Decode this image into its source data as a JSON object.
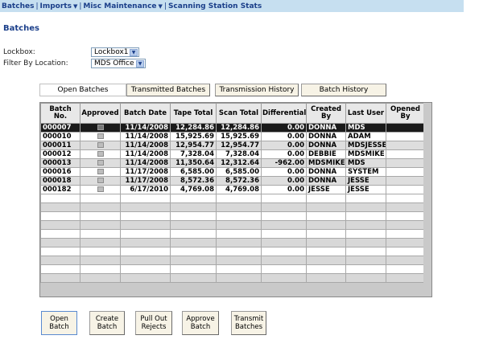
{
  "menu": {
    "batches": "Batches",
    "imports": "Imports",
    "misc_maintenance": "Misc Maintenance",
    "scanning_station_stats": "Scanning Station Stats"
  },
  "page_title": "Batches",
  "filters": {
    "lockbox_label": "Lockbox:",
    "lockbox_value": "Lockbox1",
    "location_label": "Filter By Location:",
    "location_value": "MDS Office"
  },
  "tabs": [
    {
      "label": "Open Batches"
    },
    {
      "label": "Transmitted Batches"
    },
    {
      "label": "Transmission History"
    },
    {
      "label": "Batch History"
    }
  ],
  "grid": {
    "headers": [
      "Batch No.",
      "Approved",
      "Batch Date",
      "Tape Total",
      "Scan Total",
      "Differential",
      "Created By",
      "Last User",
      "Opened By"
    ],
    "rows": [
      {
        "batch_no": "000007",
        "batch_date": "11/14/2008",
        "tape_total": "12,284.86",
        "scan_total": "12,284.86",
        "differential": "0.00",
        "created_by": "DONNA",
        "last_user": "MDS",
        "opened_by": ""
      },
      {
        "batch_no": "000010",
        "batch_date": "11/14/2008",
        "tape_total": "15,925.69",
        "scan_total": "15,925.69",
        "differential": "0.00",
        "created_by": "DONNA",
        "last_user": "ADAM",
        "opened_by": ""
      },
      {
        "batch_no": "000011",
        "batch_date": "11/14/2008",
        "tape_total": "12,954.77",
        "scan_total": "12,954.77",
        "differential": "0.00",
        "created_by": "DONNA",
        "last_user": "MDSJESSE",
        "opened_by": ""
      },
      {
        "batch_no": "000012",
        "batch_date": "11/14/2008",
        "tape_total": "7,328.04",
        "scan_total": "7,328.04",
        "differential": "0.00",
        "created_by": "DEBBIE",
        "last_user": "MDSMIKE",
        "opened_by": ""
      },
      {
        "batch_no": "000013",
        "batch_date": "11/14/2008",
        "tape_total": "11,350.64",
        "scan_total": "12,312.64",
        "differential": "-962.00",
        "created_by": "MDSMIKE",
        "last_user": "MDS",
        "opened_by": ""
      },
      {
        "batch_no": "000016",
        "batch_date": "11/17/2008",
        "tape_total": "6,585.00",
        "scan_total": "6,585.00",
        "differential": "0.00",
        "created_by": "DONNA",
        "last_user": "SYSTEM",
        "opened_by": ""
      },
      {
        "batch_no": "000018",
        "batch_date": "11/17/2008",
        "tape_total": "8,572.36",
        "scan_total": "8,572.36",
        "differential": "0.00",
        "created_by": "DONNA",
        "last_user": "JESSE",
        "opened_by": ""
      },
      {
        "batch_no": "000182",
        "batch_date": "6/17/2010",
        "tape_total": "4,769.08",
        "scan_total": "4,769.08",
        "differential": "0.00",
        "created_by": "JESSE",
        "last_user": "JESSE",
        "opened_by": ""
      }
    ]
  },
  "buttons": {
    "open_batch": "Open\nBatch",
    "create_batch": "Create\nBatch",
    "pull_out_rejects": "Pull Out\nRejects",
    "approve_batch": "Approve\nBatch",
    "transmit_batches": "Transmit\nBatches"
  },
  "colors": {
    "menu_bg": "#c6dff0",
    "title_blue": "#1b3f8a",
    "selected_row": "#1a1a1a",
    "button_bg": "#f7f3e6"
  }
}
